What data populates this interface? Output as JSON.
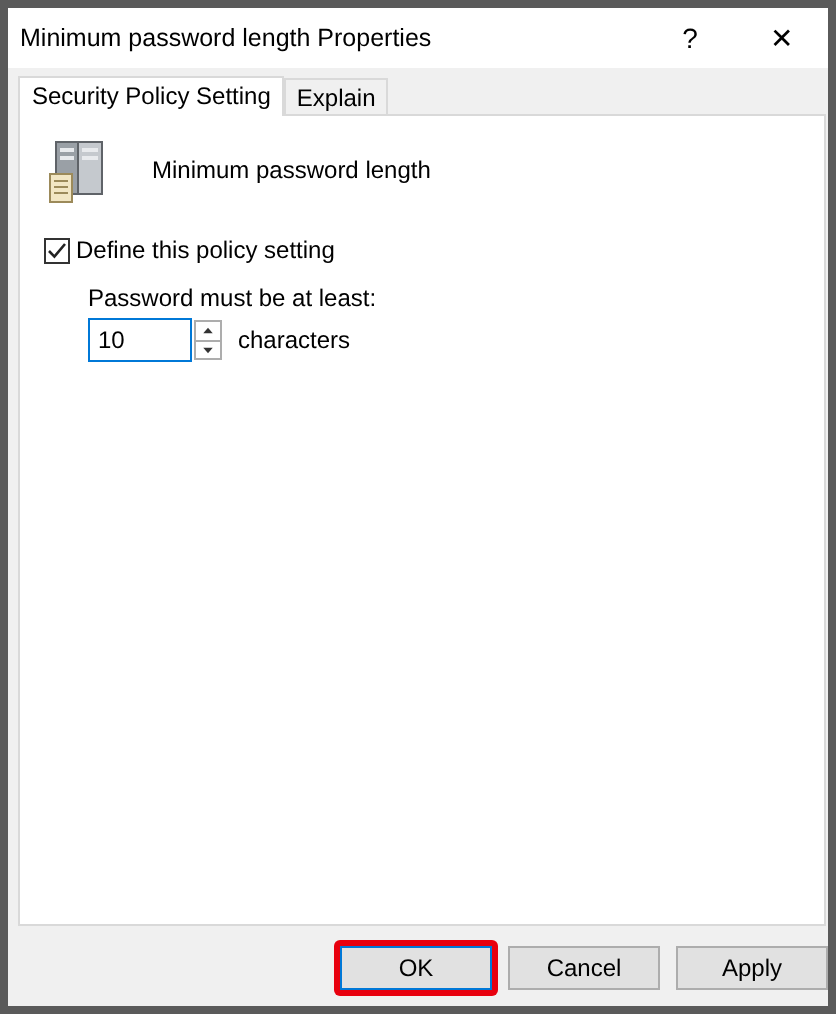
{
  "window": {
    "title": "Minimum password length Properties",
    "help": "?",
    "close": "✕"
  },
  "tabs": [
    {
      "label": "Security Policy Setting",
      "selected": true
    },
    {
      "label": "Explain",
      "selected": false
    }
  ],
  "policy": {
    "name": "Minimum password length"
  },
  "define_setting": {
    "label": "Define this policy setting",
    "checked": true
  },
  "length": {
    "label": "Password must be at least:",
    "value": "10",
    "unit": "characters"
  },
  "buttons": [
    {
      "label": "OK",
      "highlighted": true
    },
    {
      "label": "Cancel",
      "highlighted": false
    },
    {
      "label": "Apply",
      "highlighted": false
    }
  ]
}
